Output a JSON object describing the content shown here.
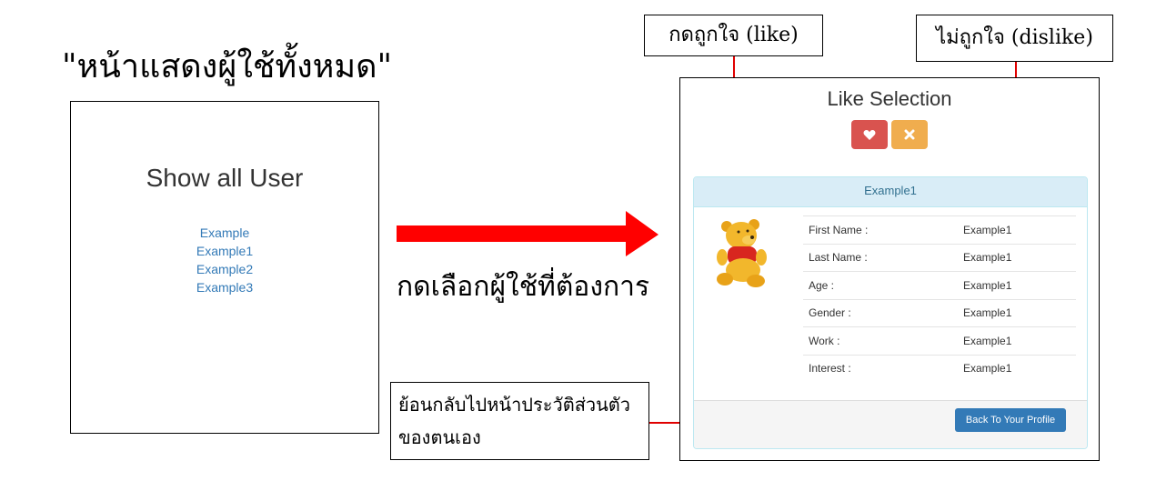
{
  "heading": "\"หน้าแสดงผู้ใช้ทั้งหมด\"",
  "left_panel": {
    "title": "Show all User",
    "users": [
      "Example",
      "Example1",
      "Example2",
      "Example3"
    ]
  },
  "arrow_caption": "กดเลือกผู้ใช้ที่ต้องการ",
  "callouts": {
    "like": "กดถูกใจ (like)",
    "dislike": "ไม่ถูกใจ (dislike)",
    "back": "ย้อนกลับไปหน้าประวัติส่วนตัวของตนเอง"
  },
  "right_panel": {
    "title": "Like Selection",
    "like_icon": "heart-icon",
    "dislike_icon": "times-icon",
    "card": {
      "header": "Example1",
      "avatar": "winnie-the-pooh-plush",
      "rows": [
        {
          "label": "First Name :",
          "value": "Example1"
        },
        {
          "label": "Last Name :",
          "value": "Example1"
        },
        {
          "label": "Age :",
          "value": "Example1"
        },
        {
          "label": "Gender :",
          "value": "Example1"
        },
        {
          "label": "Work :",
          "value": "Example1"
        },
        {
          "label": "Interest :",
          "value": "Example1"
        }
      ],
      "back_button": "Back To Your Profile"
    }
  },
  "colors": {
    "arrow": "#ff0000",
    "connector": "#e00000",
    "like_button": "#d9534f",
    "dislike_button": "#f0ad4e",
    "back_button": "#337ab7",
    "link": "#337ab7",
    "card_header_bg": "#d9edf7"
  }
}
